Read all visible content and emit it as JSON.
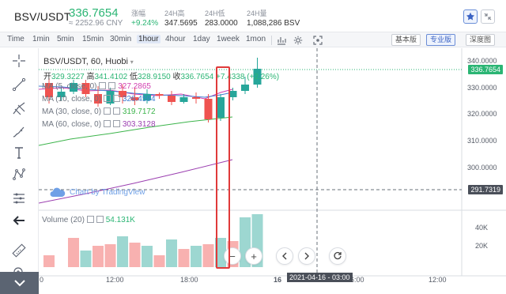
{
  "header": {
    "pair": "BSV/USDT",
    "last_price": "336.7654",
    "cny_value": "≈ 2252.96 CNY",
    "stats": [
      {
        "label": "涨幅",
        "value": "+9.24%",
        "color": "#2bb574"
      },
      {
        "label": "24H高",
        "value": "347.5695",
        "color": "#333333"
      },
      {
        "label": "24H低",
        "value": "283.0000",
        "color": "#333333"
      },
      {
        "label": "24H量",
        "value": "1,088,286 BSV",
        "color": "#333333"
      }
    ]
  },
  "toolbar": {
    "timeframes": [
      "Time",
      "1min",
      "5min",
      "15min",
      "30min",
      "1hour",
      "4hour",
      "1day",
      "1week",
      "1mon"
    ],
    "active_timeframe": "1hour",
    "modes": [
      {
        "label": "基本版",
        "active": false
      },
      {
        "label": "专业版",
        "active": true
      },
      {
        "label": "深度图",
        "active": false
      }
    ]
  },
  "chart": {
    "symbol_line": "BSV/USDT, 60, Huobi",
    "ohlc": {
      "o_label": "开",
      "o_value": "329.3227",
      "h_label": "高",
      "h_value": "341.4102",
      "l_label": "低",
      "l_value": "328.9150",
      "c_label": "收",
      "c_value": "336.7654",
      "change": "+7.4338 (+2.26%)"
    },
    "ma": [
      {
        "label": "MA (5, close, 0)",
        "value": "327.2865",
        "color": "#d13fb0"
      },
      {
        "label": "MA (10, close, 0)",
        "value": "326.4594",
        "color": "#3f7fd1"
      },
      {
        "label": "MA (30, close, 0)",
        "value": "319.7172",
        "color": "#3cb44b"
      },
      {
        "label": "MA (60, close, 0)",
        "value": "303.3128",
        "color": "#9b3fb0"
      }
    ],
    "watermark": "Chart by TradingView",
    "volume_label": "Volume (20)",
    "volume_value": "54.131K",
    "price_axis": [
      "340.0000",
      "330.0000",
      "320.0000",
      "310.0000",
      "300.0000"
    ],
    "current_price_tag": "336.7654",
    "cursor_price_tag": "291.7319",
    "volume_axis": [
      "40K",
      "20K"
    ],
    "time_axis": [
      "0",
      "12:00",
      "18:00",
      "16",
      "06:00",
      "12:00"
    ],
    "cursor_time_tag": "2021-04-16 - 03:00",
    "colors": {
      "up": "#26a69a",
      "down": "#ef5350",
      "highlight": "#e03a3a"
    }
  }
}
